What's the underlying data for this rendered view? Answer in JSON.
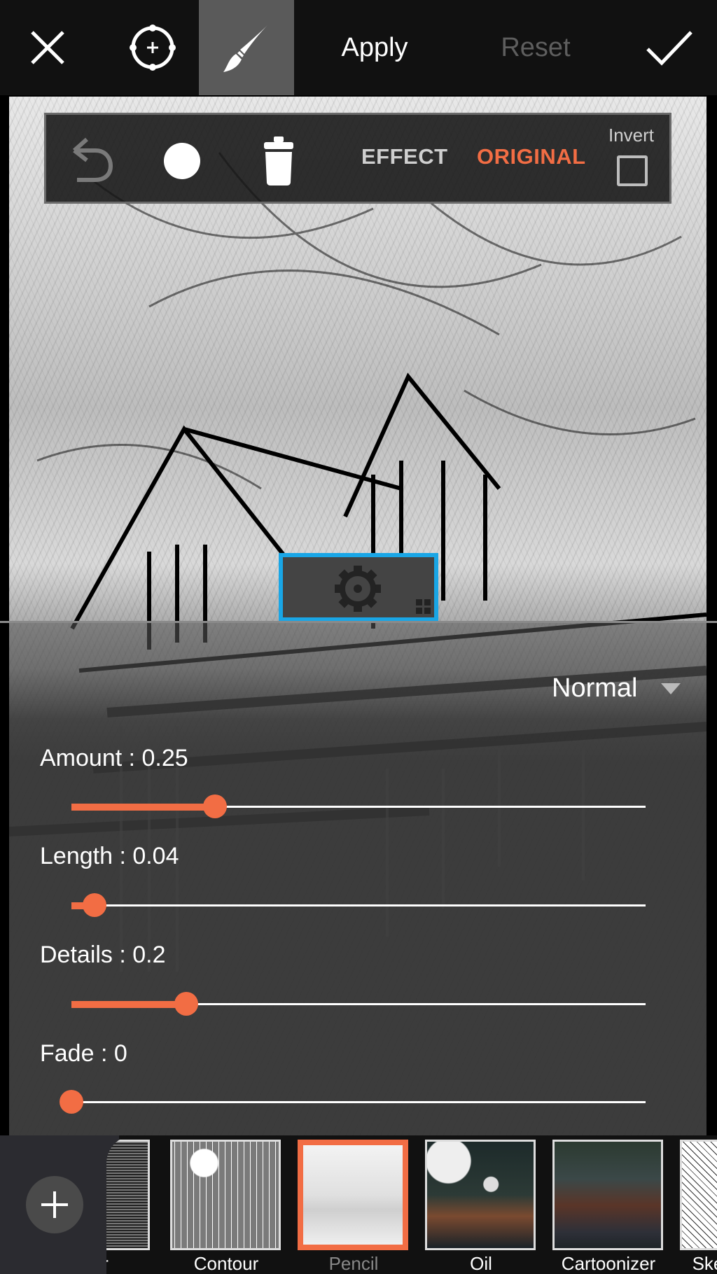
{
  "toolbar": {
    "close_icon": "close-icon",
    "target_icon": "crosshair-target-icon",
    "brush_icon": "paintbrush-icon",
    "apply_label": "Apply",
    "reset_label": "Reset",
    "done_icon": "checkmark-icon"
  },
  "brush_bar": {
    "undo_icon": "undo-icon",
    "brush_size_icon": "brush-size-circle-icon",
    "trash_icon": "trash-icon",
    "effect_label": "EFFECT",
    "original_label": "ORIGINAL",
    "invert_label": "Invert",
    "invert_checked": false
  },
  "settings_tab": {
    "icon": "gear-icon"
  },
  "blend_mode": {
    "selected": "Normal"
  },
  "sliders": [
    {
      "name": "Amount",
      "label": "Amount : 0.25",
      "value": 0.25,
      "fraction": 0.25
    },
    {
      "name": "Length",
      "label": "Length : 0.04",
      "value": 0.04,
      "fraction": 0.04
    },
    {
      "name": "Details",
      "label": "Details : 0.2",
      "value": 0.2,
      "fraction": 0.2
    },
    {
      "name": "Fade",
      "label": "Fade : 0",
      "value": 0,
      "fraction": 0
    }
  ],
  "filters": {
    "add_icon": "plus-icon",
    "items": [
      {
        "name": "her",
        "style": "img-dither",
        "selected": false
      },
      {
        "name": "Contour",
        "style": "img-contour",
        "selected": false
      },
      {
        "name": "Pencil",
        "style": "img-pencil",
        "selected": true
      },
      {
        "name": "Oil",
        "style": "img-oil",
        "selected": false
      },
      {
        "name": "Cartoonizer",
        "style": "img-cartoon",
        "selected": false
      },
      {
        "name": "Ske",
        "style": "img-sketch",
        "selected": false
      }
    ]
  },
  "colors": {
    "accent": "#f26d44",
    "selection_blue": "#19a6e6",
    "toolbar_bg": "#111111",
    "active_tool_bg": "#5a5a5a"
  }
}
